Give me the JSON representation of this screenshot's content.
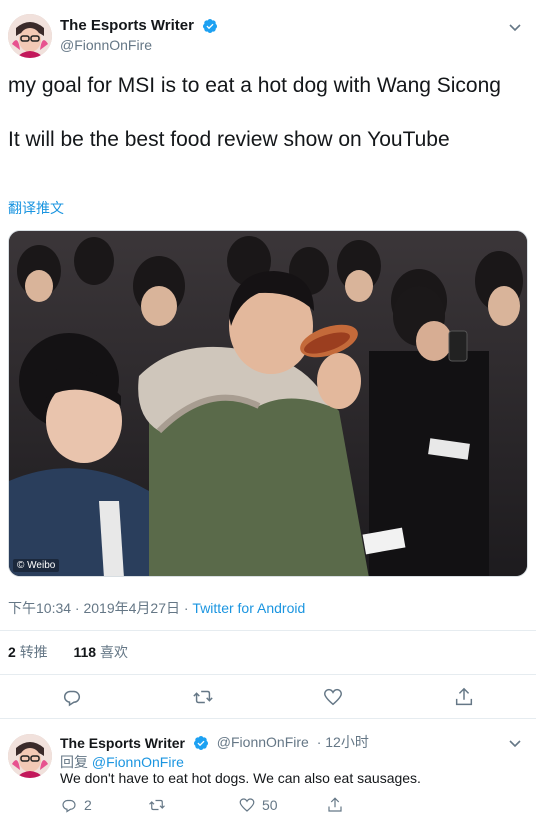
{
  "tweet": {
    "author": {
      "display_name": "The Esports Writer",
      "handle": "@FionnOnFire",
      "verified": true
    },
    "text_lines": [
      "my goal for MSI is to eat a hot dog with Wang Sicong",
      "It will be the best food review show on YouTube"
    ],
    "translate_label": "翻译推文",
    "media": {
      "watermark": "© Weibo"
    },
    "timestamp": "下午10:34 · 2019年4月27日 · ",
    "source": "Twitter for Android",
    "stats": {
      "retweets_count": "2",
      "retweets_label": "转推",
      "likes_count": "118",
      "likes_label": "喜欢"
    },
    "actions": [
      "reply-icon",
      "retweet-icon",
      "like-icon",
      "share-icon"
    ]
  },
  "reply": {
    "author": {
      "display_name": "The Esports Writer",
      "handle": "@FionnOnFire",
      "time": "· 12小时"
    },
    "reply_to_label": "回复 ",
    "reply_to_mention": "@FionnOnFire",
    "text": "We don't have to eat hot dogs. We can also eat sausages.",
    "reply_count": "2",
    "retweet_count": "",
    "like_count": "50"
  },
  "colors": {
    "accent": "#1b95e0",
    "secondary_text": "#657786",
    "primary_text": "#14171a",
    "divider": "#e6ecf0"
  }
}
